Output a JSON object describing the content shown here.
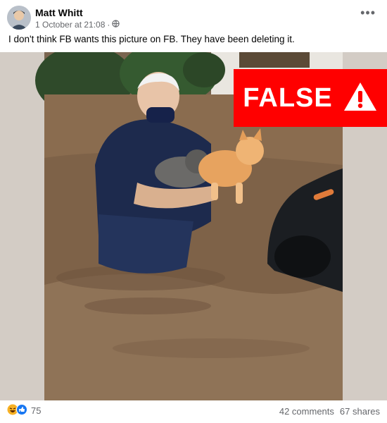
{
  "post": {
    "author": "Matt Whitt",
    "timestamp": "1 October at 21:08",
    "separator": "·",
    "audience_icon": "globe-icon",
    "more_icon": "ellipsis-icon",
    "caption": "I don't think FB wants this picture on FB. They have been deleting it."
  },
  "image": {
    "description_icon": "photo",
    "badge_text": "FALSE",
    "badge_color": "#ff0000",
    "warning_icon": "warning-icon"
  },
  "footer": {
    "reactions_count": "75",
    "comments": "42 comments",
    "shares": "67 shares",
    "reaction_icons": [
      "haha-icon",
      "like-icon"
    ]
  }
}
